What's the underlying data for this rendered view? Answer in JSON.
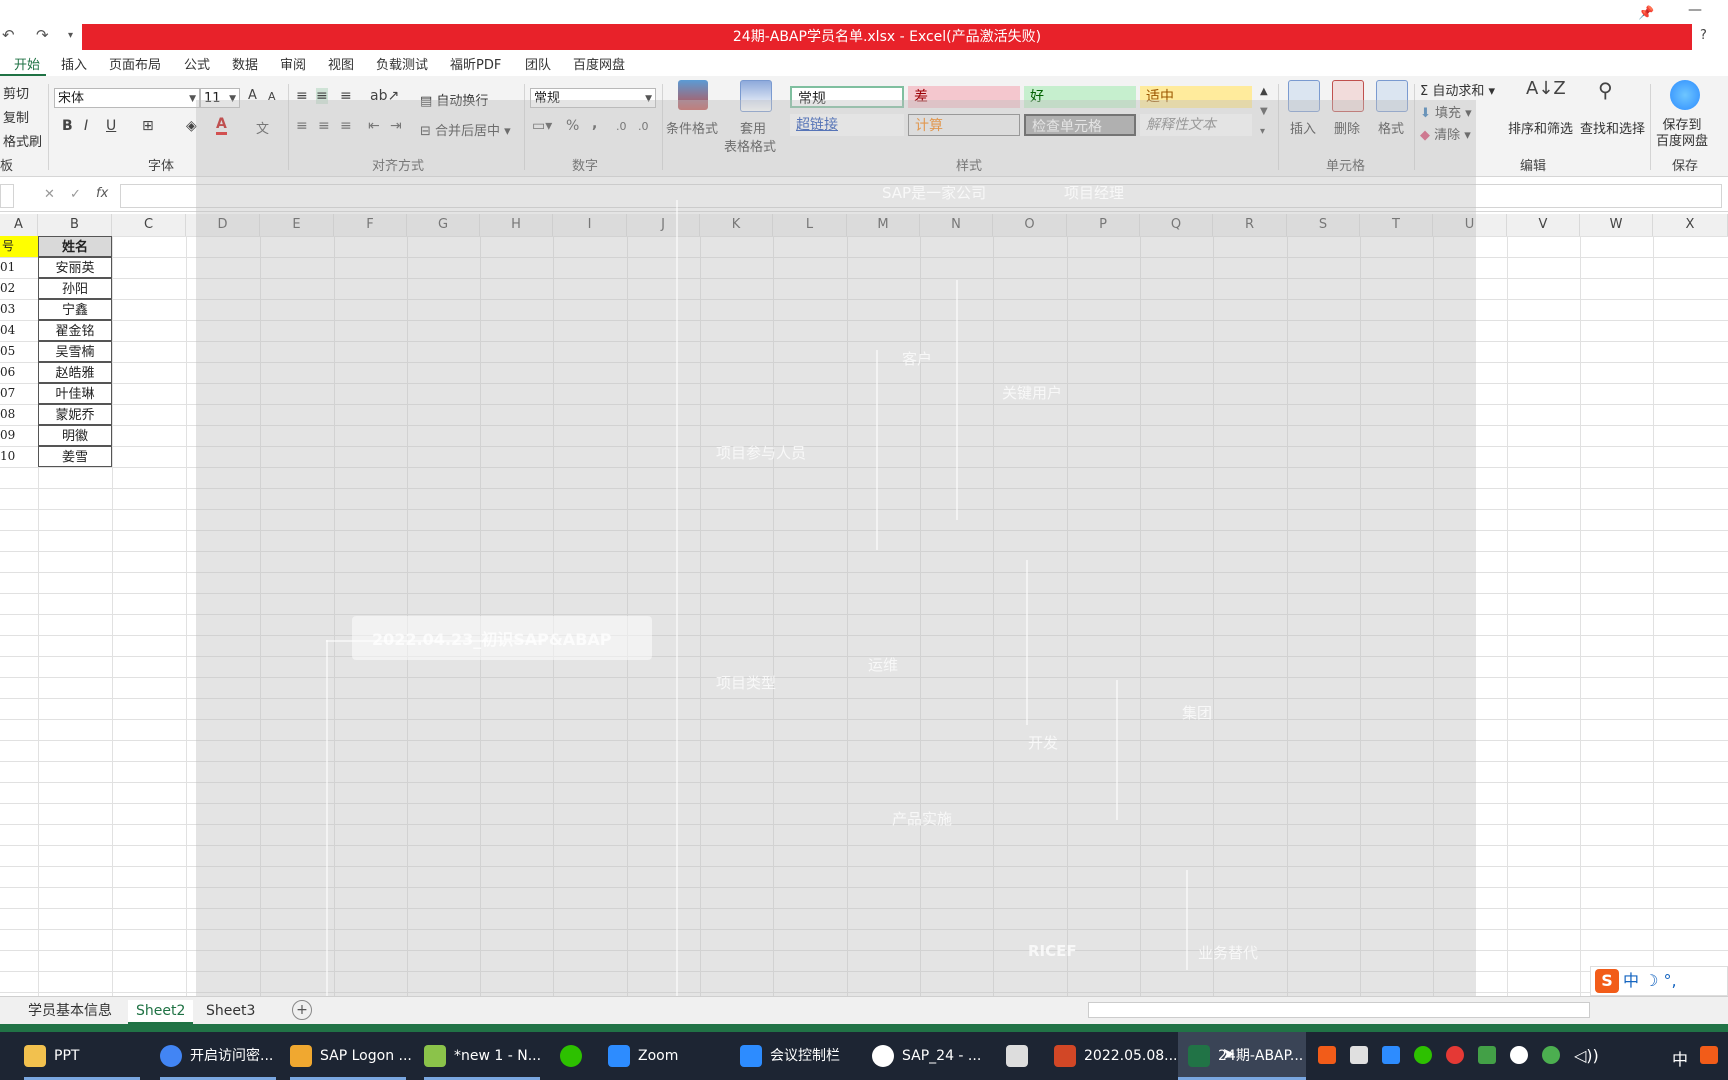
{
  "window": {
    "title": "24期-ABAP学员名单.xlsx -  Excel(产品激活失败)",
    "help": "?",
    "pin_icon": "pin-icon",
    "minimize": "—"
  },
  "quick_access": {
    "undo": "↶",
    "redo": "↷",
    "more": "▾"
  },
  "menu_tabs": [
    "开始",
    "插入",
    "页面布局",
    "公式",
    "数据",
    "审阅",
    "视图",
    "负载测试",
    "福昕PDF",
    "团队",
    "百度网盘"
  ],
  "ribbon": {
    "clipboard": {
      "cut": "剪切",
      "copy": "复制",
      "format_painter": "格式刷",
      "label": "板"
    },
    "font": {
      "name": "宋体",
      "size": "11",
      "grow": "A",
      "shrink": "A",
      "bold": "B",
      "italic": "I",
      "underline": "U",
      "font_color": "A",
      "phonetic": "文",
      "label": "字体"
    },
    "alignment": {
      "wrap": "自动换行",
      "merge": "合并后居中",
      "label": "对齐方式"
    },
    "number": {
      "format": "常规",
      "percent": "%",
      "comma": ",",
      "inc_dec": ".0",
      "label": "数字"
    },
    "styles": {
      "conditional": "条件格式",
      "table_format_1": "套用",
      "table_format_2": "表格格式",
      "cells": [
        {
          "text": "常规",
          "bg": "#ffffff",
          "fg": "#222222"
        },
        {
          "text": "差",
          "bg": "#f4c7ce",
          "fg": "#9c0006"
        },
        {
          "text": "好",
          "bg": "#c6efce",
          "fg": "#006100"
        },
        {
          "text": "适中",
          "bg": "#ffeb9c",
          "fg": "#9c5700"
        },
        {
          "text": "超链接",
          "bg": "#ffffff",
          "fg": "#0b3fb2"
        },
        {
          "text": "计算",
          "bg": "#f2f2f2",
          "fg": "#fa7d00"
        },
        {
          "text": "检查单元格",
          "bg": "#a5a5a5",
          "fg": "#ffffff"
        },
        {
          "text": "解释性文本",
          "bg": "#ffffff",
          "fg": "#7f7f7f"
        }
      ],
      "label": "样式"
    },
    "cells_group": {
      "insert": "插入",
      "delete": "删除",
      "format": "格式",
      "label": "单元格"
    },
    "editing": {
      "autosum": "自动求和",
      "fill": "填充",
      "clear": "清除",
      "sort_filter": "排序和筛选",
      "find_select": "查找和选择",
      "label": "编辑"
    },
    "save": {
      "baidu": "保存到\n百度网盘",
      "label": "保存"
    }
  },
  "formula_bar": {
    "cancel": "✕",
    "enter": "✓",
    "fx": "fx"
  },
  "columns": [
    "A",
    "B",
    "C",
    "D",
    "E",
    "F",
    "G",
    "H",
    "I",
    "J",
    "K",
    "L",
    "M",
    "N",
    "O",
    "P",
    "Q",
    "R",
    "S",
    "T",
    "U",
    "V",
    "W",
    "X"
  ],
  "table": {
    "header_id": "号",
    "header_name": "姓名",
    "rows": [
      {
        "id": "01",
        "name": "安丽英"
      },
      {
        "id": "02",
        "name": "孙阳"
      },
      {
        "id": "03",
        "name": "宁鑫"
      },
      {
        "id": "04",
        "name": "翟金铭"
      },
      {
        "id": "05",
        "name": "吴雪楠"
      },
      {
        "id": "06",
        "name": "赵皓雅"
      },
      {
        "id": "07",
        "name": "叶佳琳"
      },
      {
        "id": "08",
        "name": "蒙妮乔"
      },
      {
        "id": "09",
        "name": "明徽"
      },
      {
        "id": "10",
        "name": "姜雪"
      }
    ]
  },
  "overlay_mindmap": {
    "root": "2022.04.23_初识SAP&ABAP",
    "nodes": [
      "SAP是一家公司",
      "项目参与人员",
      "客户",
      "关键用户",
      "项目类型",
      "产品实施",
      "运维",
      "开发",
      "集团",
      "RICEF",
      "业务替代",
      "项目经理"
    ]
  },
  "sheet_tabs": [
    "学员基本信息",
    "Sheet2",
    "Sheet3"
  ],
  "add_sheet": "+",
  "taskbar": {
    "items": [
      {
        "label": "PPT",
        "color": "#f2c14e"
      },
      {
        "label": "开启访问密...",
        "color": "#4285f4"
      },
      {
        "label": "SAP Logon ...",
        "color": "#f0a830"
      },
      {
        "label": "*new 1 - N...",
        "color": "#8bc34a"
      },
      {
        "label": "",
        "color": "#2dc100"
      },
      {
        "label": "Zoom",
        "color": "#2d8cff"
      },
      {
        "label": "会议控制栏",
        "color": "#2d8cff"
      },
      {
        "label": "SAP_24 - ...",
        "color": "#ffffff"
      },
      {
        "label": "",
        "color": "#dddddd"
      },
      {
        "label": "2022.05.08...",
        "color": "#d24726"
      },
      {
        "label": "24期-ABAP...",
        "color": "#217346"
      }
    ],
    "clock_ime": "中",
    "ime_bar": "中 ☽ °,"
  }
}
